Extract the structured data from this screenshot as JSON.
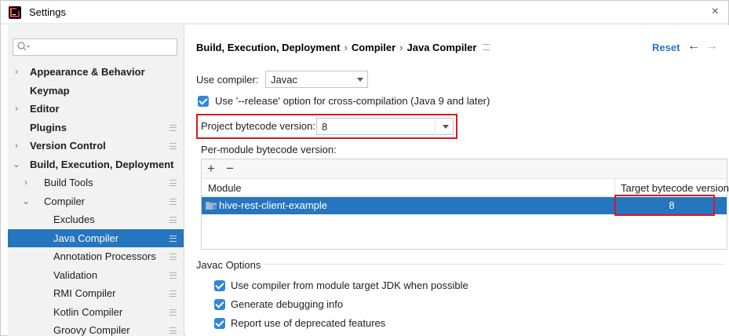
{
  "window": {
    "title": "Settings",
    "close_glyph": "×"
  },
  "sidebar": {
    "search_placeholder": "",
    "items": [
      {
        "label": "Appearance & Behavior",
        "bold": true,
        "chevron": "›",
        "level": 0
      },
      {
        "label": "Keymap",
        "bold": true,
        "chevron": "",
        "level": 0
      },
      {
        "label": "Editor",
        "bold": true,
        "chevron": "›",
        "level": 0
      },
      {
        "label": "Plugins",
        "bold": true,
        "chevron": "",
        "level": 0,
        "settings_icon": true
      },
      {
        "label": "Version Control",
        "bold": true,
        "chevron": "›",
        "level": 0,
        "settings_icon": true
      },
      {
        "label": "Build, Execution, Deployment",
        "bold": true,
        "chevron": "⌄",
        "level": 0
      },
      {
        "label": "Build Tools",
        "bold": false,
        "chevron": "›",
        "level": 1,
        "settings_icon": true
      },
      {
        "label": "Compiler",
        "bold": false,
        "chevron": "⌄",
        "level": 1,
        "settings_icon": true
      },
      {
        "label": "Excludes",
        "bold": false,
        "chevron": "",
        "level": 2,
        "settings_icon": true
      },
      {
        "label": "Java Compiler",
        "bold": false,
        "chevron": "",
        "level": 2,
        "settings_icon": true,
        "selected": true
      },
      {
        "label": "Annotation Processors",
        "bold": false,
        "chevron": "",
        "level": 2,
        "settings_icon": true
      },
      {
        "label": "Validation",
        "bold": false,
        "chevron": "",
        "level": 2,
        "settings_icon": true
      },
      {
        "label": "RMI Compiler",
        "bold": false,
        "chevron": "",
        "level": 2,
        "settings_icon": true
      },
      {
        "label": "Kotlin Compiler",
        "bold": false,
        "chevron": "",
        "level": 2,
        "settings_icon": true
      },
      {
        "label": "Groovy Compiler",
        "bold": false,
        "chevron": "",
        "level": 2,
        "settings_icon": true
      }
    ]
  },
  "header": {
    "breadcrumb": [
      "Build, Execution, Deployment",
      "Compiler",
      "Java Compiler"
    ],
    "breadcrumb_sep": "›",
    "reset_label": "Reset",
    "back_glyph": "←",
    "forward_glyph": "→"
  },
  "compiler": {
    "use_compiler_label": "Use compiler:",
    "use_compiler_value": "Javac",
    "release_option_label": "Use '--release' option for cross-compilation (Java 9 and later)",
    "release_option_checked": true,
    "project_bytecode_label": "Project bytecode version:",
    "project_bytecode_value": "8",
    "per_module_label": "Per-module bytecode version:"
  },
  "module_table": {
    "add_glyph": "+",
    "remove_glyph": "−",
    "columns": [
      "Module",
      "Target bytecode version"
    ],
    "rows": [
      {
        "module": "hive-rest-client-example",
        "target": "8",
        "selected": true
      }
    ]
  },
  "javac_options": {
    "section_title": "Javac Options",
    "options": [
      {
        "label": "Use compiler from module target JDK when possible",
        "checked": true
      },
      {
        "label": "Generate debugging info",
        "checked": true
      },
      {
        "label": "Report use of deprecated features",
        "checked": true
      }
    ]
  },
  "colors": {
    "selection": "#2675bf",
    "accent_link": "#2873c8",
    "checkbox": "#2f87d8",
    "highlight_box": "#e0161b"
  }
}
